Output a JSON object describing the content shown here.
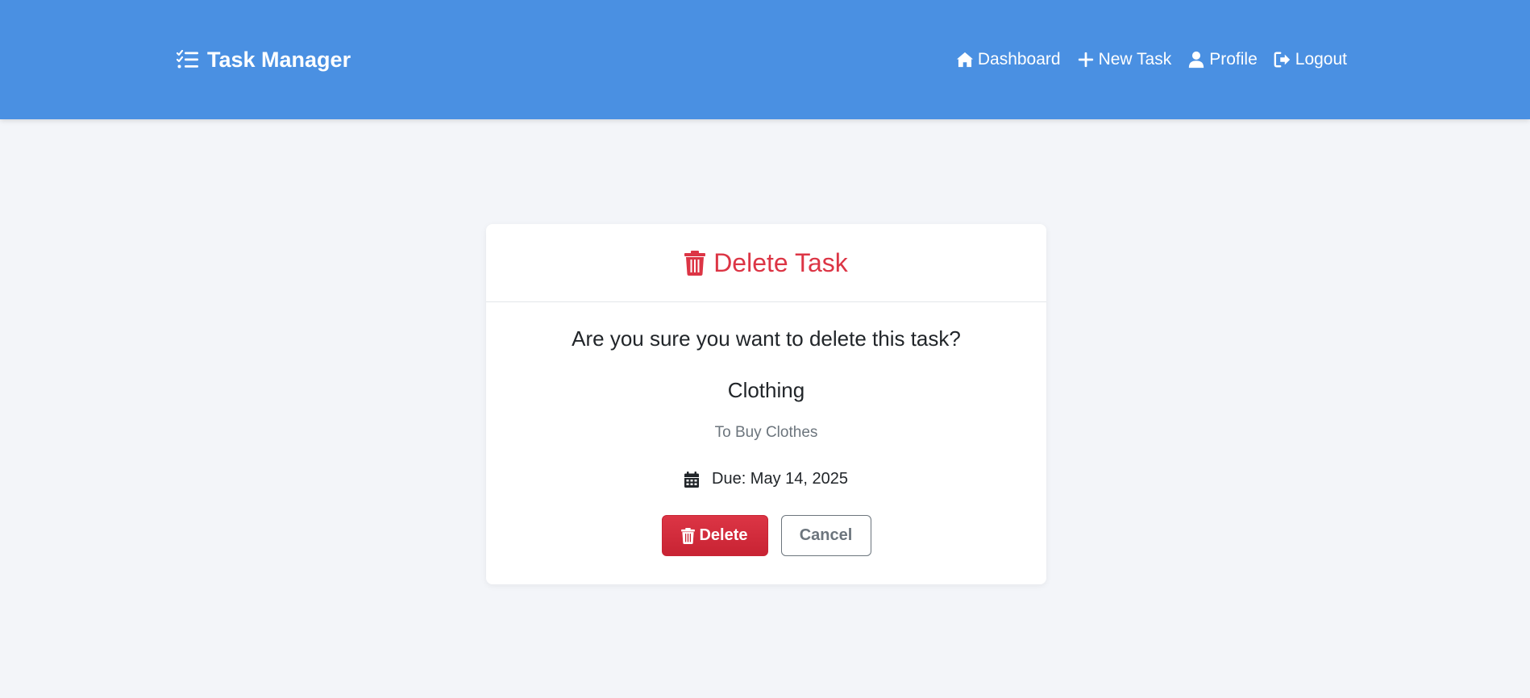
{
  "navbar": {
    "brand": "Task Manager",
    "brand_icon": "task-list-icon",
    "links": [
      {
        "label": "Dashboard",
        "icon": "home-icon"
      },
      {
        "label": "New Task",
        "icon": "plus-icon"
      },
      {
        "label": "Profile",
        "icon": "user-icon"
      },
      {
        "label": "Logout",
        "icon": "logout-icon"
      }
    ]
  },
  "card": {
    "title": "Delete Task",
    "title_icon": "trash-icon",
    "question": "Are you sure you want to delete this task?",
    "task": {
      "title": "Clothing",
      "description": "To Buy Clothes",
      "due": "Due: May 14, 2025",
      "due_icon": "calendar-icon"
    },
    "actions": {
      "delete_label": "Delete",
      "cancel_label": "Cancel"
    }
  },
  "colors": {
    "navbar": "#4a90e2",
    "danger": "#dc3545",
    "background": "#f3f5f9",
    "muted": "#6c757d"
  }
}
